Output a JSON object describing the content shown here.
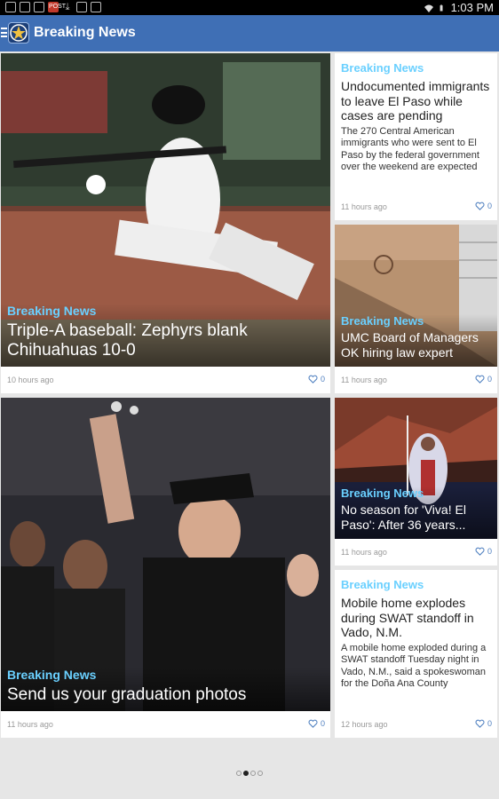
{
  "status_bar": {
    "notifications": [
      "image-icon",
      "mail-icon",
      "window-icon",
      "news-icon",
      "download-icon",
      "flipboard-icon",
      "bag-icon"
    ],
    "notif_labels": {
      "news-icon": "POST"
    },
    "time": "1:03 PM"
  },
  "app_bar": {
    "title": "Breaking News"
  },
  "cards": [
    {
      "category": "Breaking News",
      "headline": "Triple-A baseball: Zephyrs blank Chihuahuas 10-0",
      "time": "10 hours ago",
      "likes": "0"
    },
    {
      "category": "Breaking News",
      "headline": "Undocumented immigrants to leave El Paso while cases are pending",
      "summary": "The 270 Central American immigrants who were sent to El Paso by the federal government over the weekend are expected to...",
      "time": "11 hours ago",
      "likes": "0"
    },
    {
      "category": "Breaking News",
      "headline": "UMC Board of Managers OK hiring law expert",
      "time": "11 hours ago",
      "likes": "0"
    },
    {
      "category": "Breaking News",
      "headline": "Send us your graduation photos",
      "time": "11 hours ago",
      "likes": "0"
    },
    {
      "category": "Breaking News",
      "headline": "No season for 'Viva! El Paso': After 36 years...",
      "time": "11 hours ago",
      "likes": "0"
    },
    {
      "category": "Breaking News",
      "headline": "Mobile home explodes during SWAT standoff in Vado, N.M.",
      "summary": "A mobile home exploded during a SWAT standoff Tuesday night in Vado, N.M., said a spokeswoman for the Doña Ana County Sheriff's...",
      "time": "12 hours ago",
      "likes": "0"
    }
  ],
  "pager": {
    "pages": 4,
    "active": 2
  }
}
